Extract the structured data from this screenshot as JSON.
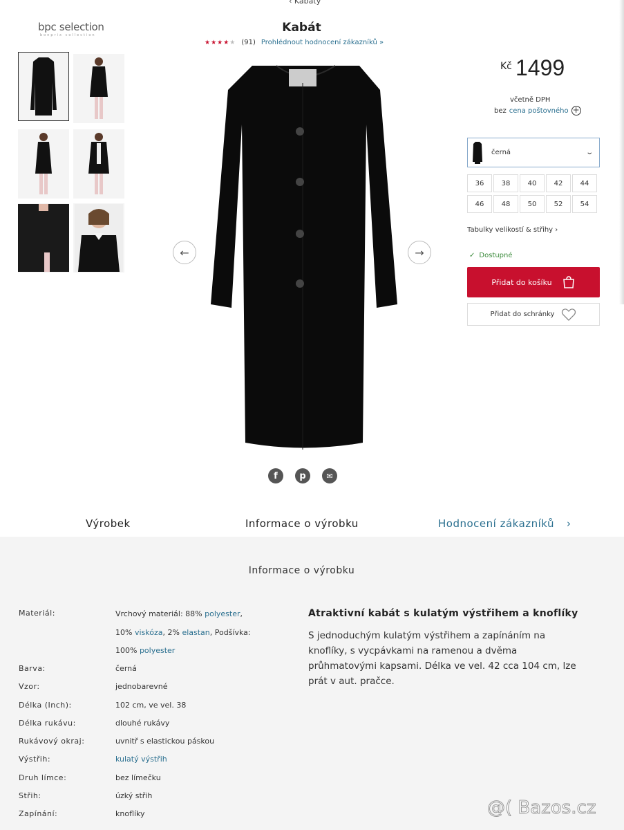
{
  "breadcrumb": "‹ Kabáty",
  "brand": {
    "name": "bpc selection",
    "sub": "bonprix collection"
  },
  "product": {
    "title": "Kabát",
    "stars": "★★★★",
    "star_empty": "★",
    "review_count": "(91)",
    "reviews_link": "Prohlédnout hodnocení zákazníků »"
  },
  "price": {
    "currency": "Kč",
    "value": "1499",
    "vat": "včetně DPH",
    "ship_prefix": "bez",
    "ship_link": "cena poštovného",
    "ship_icon": "+"
  },
  "color": {
    "label": "černá",
    "chevron": "⌄"
  },
  "sizes": [
    "36",
    "38",
    "40",
    "42",
    "44",
    "46",
    "48",
    "50",
    "52",
    "54"
  ],
  "size_table": "Tabulky velikostí & střihy  ›",
  "availability": {
    "check": "✓",
    "label": "Dostupné"
  },
  "buttons": {
    "add_cart": "Přidat do košíku",
    "add_wish": "Přidat do schránky",
    "prev": "←",
    "next": "→"
  },
  "share": {
    "facebook": "f",
    "pinterest": "p",
    "email": "✉"
  },
  "tabs": [
    "Výrobek",
    "Informace o výrobku",
    "Hodnocení zákazníků",
    "›"
  ],
  "info": {
    "title": "Informace o výrobku",
    "specs": [
      {
        "k": "Materiál:",
        "v1": "Vrchový materiál: 88% ",
        "l1": "polyester",
        "v2": ",",
        "v3": "10% ",
        "l2": "viskóza",
        "v4": ", 2% ",
        "l3": "elastan",
        "v5": ", Podšívka:",
        "v6": "100% ",
        "l4": "polyester"
      },
      {
        "k": "Barva:",
        "v": "černá"
      },
      {
        "k": "Vzor:",
        "v": "jednobarevné"
      },
      {
        "k": "Délka (Inch):",
        "v": "102 cm, ve vel. 38"
      },
      {
        "k": "Délka rukávu:",
        "v": "dlouhé rukávy"
      },
      {
        "k": "Rukávový okraj:",
        "v": "uvnitř s elastickou páskou"
      },
      {
        "k": "Výstřih:",
        "v": "kulatý výstřih"
      },
      {
        "k": "Druh límce:",
        "v": "bez límečku"
      },
      {
        "k": "Střih:",
        "v": "úzký střih"
      },
      {
        "k": "Zapínání:",
        "v": "knoflíky"
      }
    ],
    "desc_title": "Atraktivní kabát s kulatým výstřihem a knoflíky",
    "desc": "S jednoduchým kulatým výstřihem a zapínáním na knoflíky, s vycpávkami na ramenou a dvěma průhmatovými kapsami. Délka ve vel. 42 cca 104 cm, lze prát v aut. pračce."
  },
  "watermark": "@( Bazos.cz"
}
